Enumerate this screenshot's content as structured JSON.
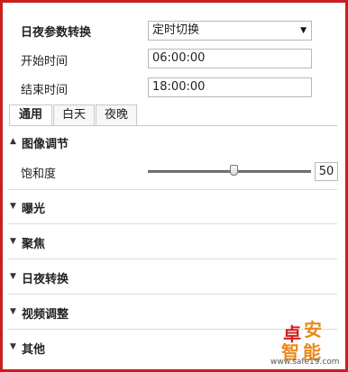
{
  "settings": {
    "day_night_switch_label": "日夜参数转换",
    "day_night_switch_value": "定时切换",
    "start_time_label": "开始时间",
    "start_time_value": "06:00:00",
    "end_time_label": "结束时间",
    "end_time_value": "18:00:00"
  },
  "tabs": [
    {
      "label": "通用",
      "active": true
    },
    {
      "label": "白天",
      "active": false
    },
    {
      "label": "夜晚",
      "active": false
    }
  ],
  "sections": [
    {
      "title": "图像调节",
      "expanded": true
    },
    {
      "title": "曝光",
      "expanded": false
    },
    {
      "title": "聚焦",
      "expanded": false
    },
    {
      "title": "日夜转换",
      "expanded": false
    },
    {
      "title": "视频调整",
      "expanded": false
    },
    {
      "title": "其他",
      "expanded": false
    }
  ],
  "image_adjust": {
    "saturation_label": "饱和度",
    "saturation_value": "50",
    "saturation_max": 100
  },
  "icons": {
    "expanded": "chevron-up-icon",
    "collapsed": "chevron-down-icon",
    "dropdown": "caret-down-icon"
  },
  "watermark": {
    "chars": [
      "卓",
      "安",
      "智",
      "能"
    ],
    "url": "www.safe19.com"
  },
  "colors": {
    "frame": "#c81e1e",
    "watermark_red": "#d21e1e",
    "watermark_orange": "#e98a1a"
  }
}
